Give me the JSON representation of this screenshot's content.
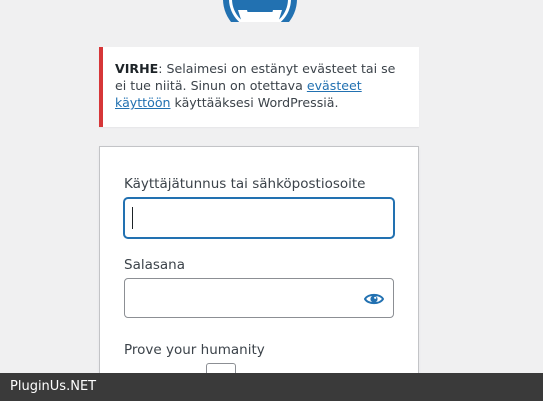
{
  "notice": {
    "strong": "VIRHE",
    "text_before": ": Selaimesi on estänyt evästeet tai se ei tue niitä. Sinun on otettava ",
    "link": "evästeet käyttöön",
    "text_after": " käyttääksesi WordPressiä."
  },
  "form": {
    "username_label": "Käyttäjätunnus tai sähköpostiosoite",
    "username_value": "",
    "password_label": "Salasana",
    "password_value": "",
    "humanity_label": "Prove your humanity"
  },
  "footer": {
    "watermark": "PluginUs.NET"
  },
  "colors": {
    "accent": "#2271b1",
    "error": "#d63638",
    "footer_bg": "#3a3a3a"
  },
  "icons": [
    "wordpress-logo-icon",
    "eye-icon"
  ]
}
